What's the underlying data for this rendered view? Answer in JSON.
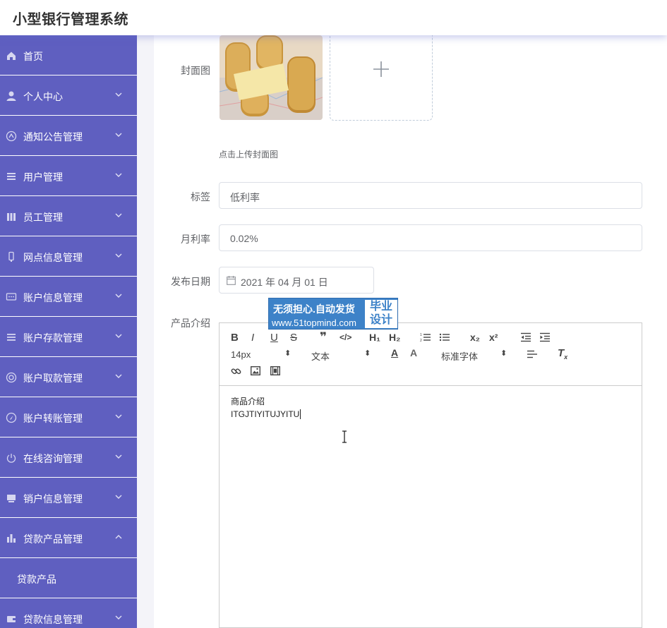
{
  "header": {
    "title": "小型银行管理系统"
  },
  "sidebar": {
    "items": [
      {
        "label": "首页",
        "icon": "home-icon",
        "expanded": null
      },
      {
        "label": "个人中心",
        "icon": "user-icon",
        "expanded": false
      },
      {
        "label": "通知公告管理",
        "icon": "notice-icon",
        "expanded": false
      },
      {
        "label": "用户管理",
        "icon": "list-icon",
        "expanded": false
      },
      {
        "label": "员工管理",
        "icon": "staff-icon",
        "expanded": false
      },
      {
        "label": "网点信息管理",
        "icon": "branch-icon",
        "expanded": false
      },
      {
        "label": "账户信息管理",
        "icon": "account-icon",
        "expanded": false
      },
      {
        "label": "账户存款管理",
        "icon": "deposit-icon",
        "expanded": false
      },
      {
        "label": "账户取款管理",
        "icon": "withdraw-icon",
        "expanded": false
      },
      {
        "label": "账户转账管理",
        "icon": "transfer-icon",
        "expanded": false
      },
      {
        "label": "在线咨询管理",
        "icon": "power-icon",
        "expanded": false
      },
      {
        "label": "销户信息管理",
        "icon": "close-account-icon",
        "expanded": false
      },
      {
        "label": "贷款产品管理",
        "icon": "bar-chart-icon",
        "expanded": true
      },
      {
        "label": "贷款信息管理",
        "icon": "wallet-icon",
        "expanded": false
      }
    ],
    "submenu": {
      "label": "贷款产品"
    }
  },
  "form": {
    "cover_label": "封面图",
    "upload_hint": "点击上传封面图",
    "tag_label": "标签",
    "tag_value": "低利率",
    "rate_label": "月利率",
    "rate_value": "0.02%",
    "date_label": "发布日期",
    "date_value": "2021 年 04 月 01 日",
    "intro_label": "产品介绍"
  },
  "editor": {
    "font_size": "14px",
    "block_format": "文本",
    "font_family": "标准字体",
    "content_line1": "商品介绍",
    "content_line2": "ITGJTIYITUJYITU"
  },
  "watermark": {
    "line1": "无须担心.自动发货",
    "line2": "www.51topmind.com",
    "right1": "毕业",
    "right2": "设计"
  },
  "colors": {
    "sidebar": "#5f5fc0",
    "accent": "#3d82c8"
  }
}
